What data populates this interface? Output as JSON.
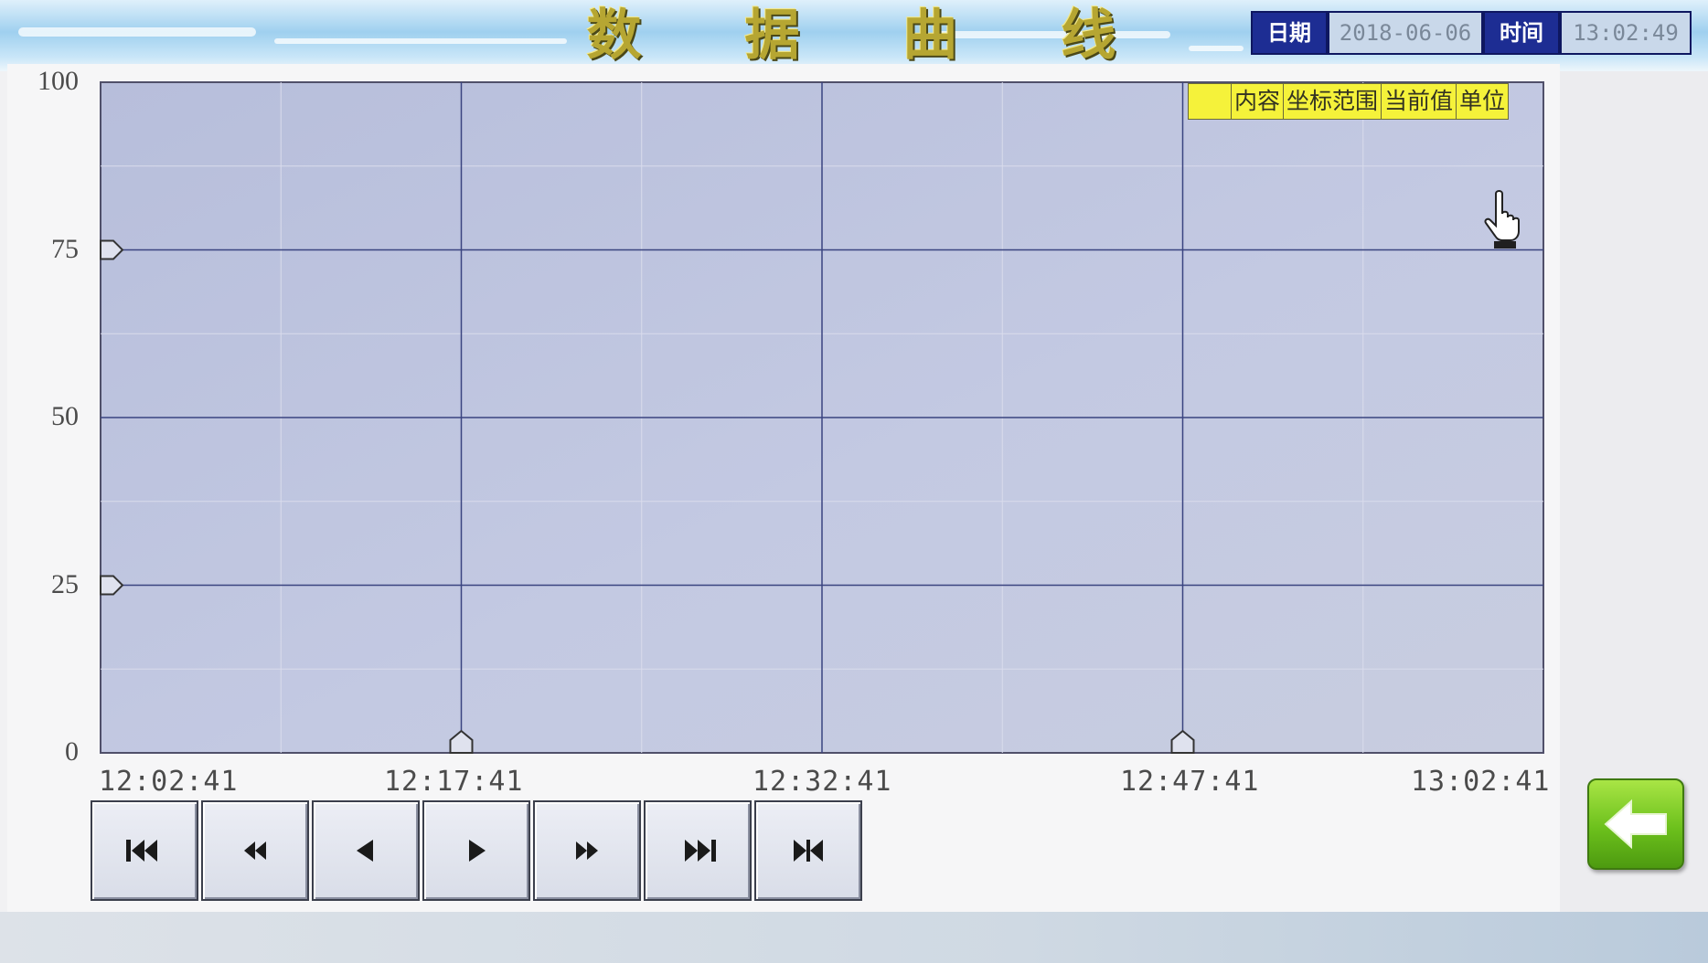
{
  "header": {
    "title": "数 据 曲 线",
    "date_label": "日期",
    "date_value": "2018-06-06",
    "time_label": "时间",
    "time_value": "13:02:49"
  },
  "legend": {
    "col_content": "内容",
    "col_range": "坐标范围",
    "col_current": "当前值",
    "col_unit": "单位"
  },
  "chart_data": {
    "type": "line",
    "y_ticks": [
      "100",
      "75",
      "50",
      "25",
      "0"
    ],
    "x_ticks": [
      "12:02:41",
      "12:17:41",
      "12:32:41",
      "12:47:41",
      "13:02:41"
    ],
    "ylim": [
      0,
      100
    ],
    "grid": true,
    "series": []
  },
  "navigation": {
    "buttons": [
      {
        "icon": "skip-to-start-icon"
      },
      {
        "icon": "fast-rewind-icon"
      },
      {
        "icon": "step-back-icon"
      },
      {
        "icon": "step-forward-icon"
      },
      {
        "icon": "fast-forward-icon"
      },
      {
        "icon": "skip-to-end-icon"
      },
      {
        "icon": "jump-to-latest-icon"
      }
    ],
    "back_icon": "back-arrow-icon"
  },
  "colors": {
    "plot_background": "#bcc2dc",
    "grid_major": "#3a4480",
    "legend_background": "#f5f23a",
    "back_button": "#6cc01c",
    "date_label_background": "#1d2d93"
  }
}
